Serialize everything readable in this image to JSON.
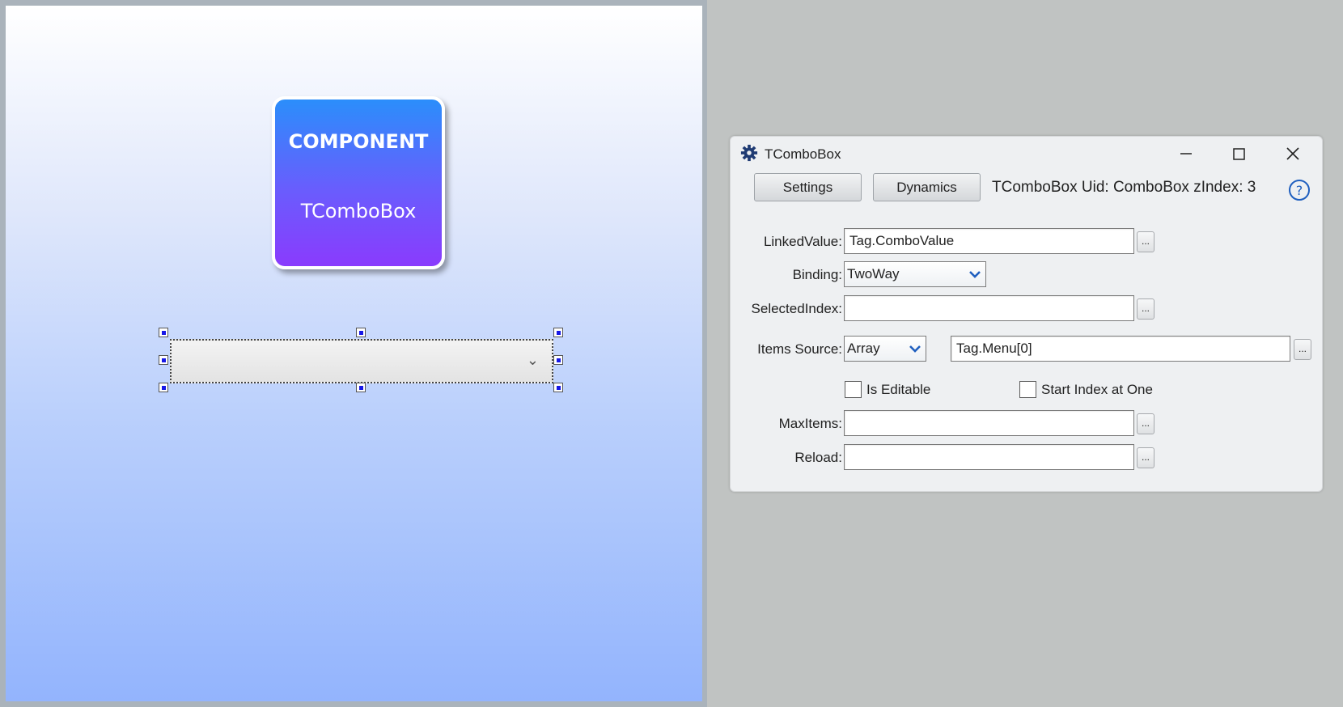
{
  "canvas": {
    "component_card": {
      "title": "COMPONENT",
      "subtitle": "TComboBox"
    },
    "selected_combo": {
      "value": ""
    }
  },
  "properties_window": {
    "title": "TComboBox",
    "tabs": {
      "settings": "Settings",
      "dynamics": "Dynamics"
    },
    "uid_text": "TComboBox Uid: ComboBox zIndex: 3",
    "fields": {
      "linked_value": {
        "label": "LinkedValue:",
        "value": "Tag.ComboValue"
      },
      "binding": {
        "label": "Binding:",
        "value": "TwoWay"
      },
      "selected_index": {
        "label": "SelectedIndex:",
        "value": ""
      },
      "items_source": {
        "label": "Items Source:",
        "type_value": "Array",
        "value": "Tag.Menu[0]"
      },
      "is_editable": {
        "label": "Is Editable",
        "checked": false
      },
      "start_index_at_one": {
        "label": "Start Index at One",
        "checked": false
      },
      "max_items": {
        "label": "MaxItems:",
        "value": ""
      },
      "reload": {
        "label": "Reload:",
        "value": ""
      }
    },
    "ellipsis": "..."
  },
  "colors": {
    "accent_blue": "#1f5fbf",
    "card_gradient_top": "#2b8efb",
    "card_gradient_bottom": "#8a3bfd"
  }
}
